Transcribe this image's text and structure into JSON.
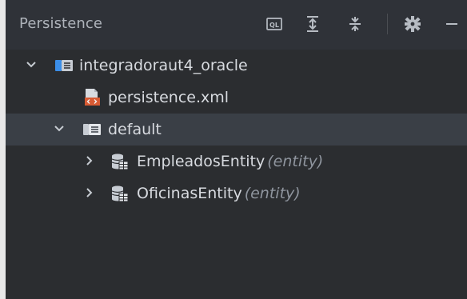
{
  "panel": {
    "title": "Persistence",
    "toolbar": {
      "ql_label": "QL",
      "expand_all": "expand-all-icon",
      "collapse_all": "collapse-all-icon",
      "settings": "gear-icon",
      "minimize": "minimize-icon"
    }
  },
  "tree": {
    "module": {
      "label": "integradoraut4_oracle",
      "icon": "module-icon"
    },
    "config_file": {
      "label": "persistence.xml",
      "icon": "xml-file-icon"
    },
    "unit": {
      "label": "default",
      "icon": "persistence-unit-icon"
    },
    "entities": [
      {
        "name": "EmpleadosEntity",
        "kind": "(entity)",
        "icon": "entity-icon"
      },
      {
        "name": "OficinasEntity",
        "kind": "(entity)",
        "icon": "entity-icon"
      }
    ]
  },
  "colors": {
    "panel_bg": "#2b2d30",
    "header_bg": "#2f3238",
    "selected_row": "#3a3f46",
    "text": "#d8dbe0",
    "muted_text": "#8f959e",
    "accent_blue": "#3b8ee8",
    "xml_orange": "#d85b34"
  }
}
